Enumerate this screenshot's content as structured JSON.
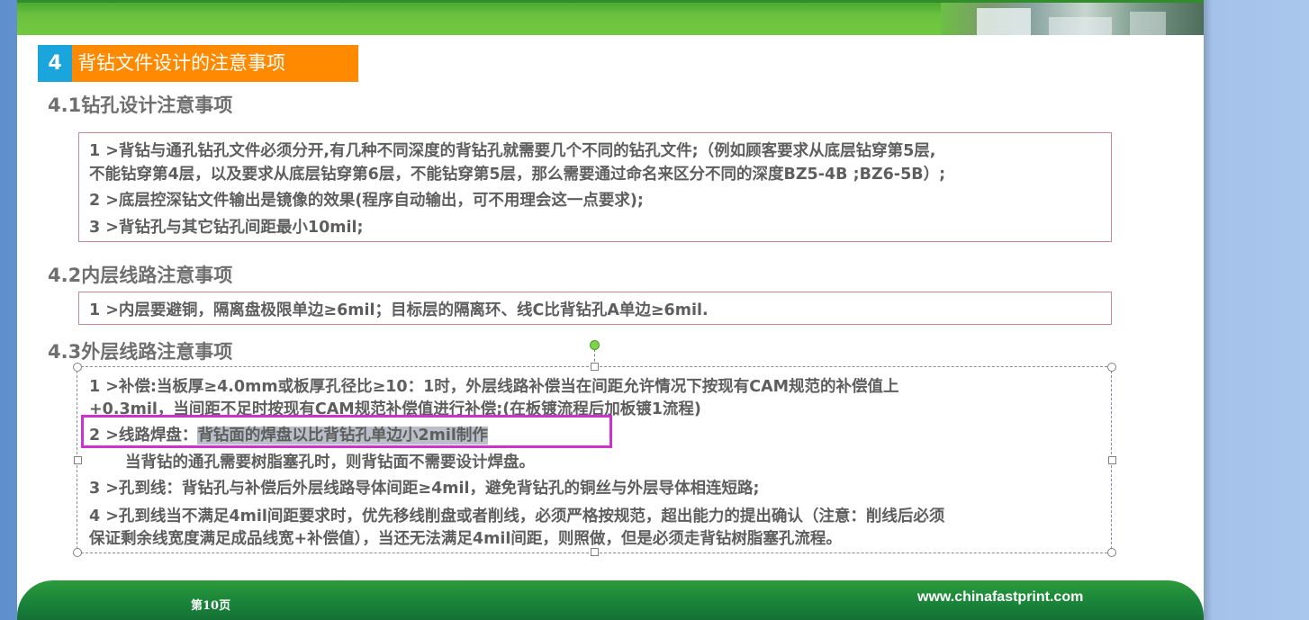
{
  "section": {
    "number": "4",
    "title": "背钻文件设计的注意事项"
  },
  "s1": {
    "heading": "4.1钻孔设计注意事项",
    "lines": [
      "1 >背钻与通孔钻孔文件必须分开,有几种不同深度的背钻孔就需要几个不同的钻孔文件;（例如顾客要求从底层钻穿第5层,",
      "不能钻穿第4层，以及要求从底层钻穿第6层，不能钻穿第5层，那么需要通过命名来区分不同的深度BZ5-4B ;BZ6-5B）;",
      "2 >底层控深钻文件输出是镜像的效果(程序自动输出，可不用理会这一点要求);",
      "3 >背钻孔与其它钻孔间距最小10mil;"
    ]
  },
  "s2": {
    "heading": "4.2内层线路注意事项",
    "lines": [
      "1 >内层要避铜，隔离盘极限单边≥6mil；目标层的隔离环、线C比背钻孔A单边≥6mil."
    ]
  },
  "s3": {
    "heading": "4.3外层线路注意事项",
    "line1a": "1 >补偿:当板厚≥4.0mm或板厚孔径比≥10：1时，外层线路补偿当在间距允许情况下按现有CAM规范的补偿值上",
    "line1b": "+0.3mil，当间距不足时按现有CAM规范补偿值进行补偿;(在板镀流程后加板镀1流程)",
    "line2_prefix": "2 >线路焊盘：",
    "line2_highlight": "背钻面的焊盘以比背钻孔单边小2mil制作",
    "line2b": "当背钻的通孔需要树脂塞孔时，则背钻面不需要设计焊盘。",
    "line3": "3 >孔到线：背钻孔与补偿后外层线路导体间距≥4mil，避免背钻孔的铜丝与外层导体相连短路;",
    "line4a": "4 >孔到线当不满足4mil间距要求时，优先移线削盘或者削线，必须严格按规范，超出能力的提出确认（注意：削线后必须",
    "line4b": "保证剩余线宽度满足成品线宽+补偿值），当还无法满足4mil间距，则照做，但是必须走背钻树脂塞孔流程。"
  },
  "footer": {
    "page": "第10页",
    "url": "www.chinafastprint.com"
  },
  "colors": {
    "accent_blue": "#1aa5dc",
    "accent_orange": "#ff8a00",
    "green": "#6cc23f",
    "focus": "#cc33cc"
  }
}
